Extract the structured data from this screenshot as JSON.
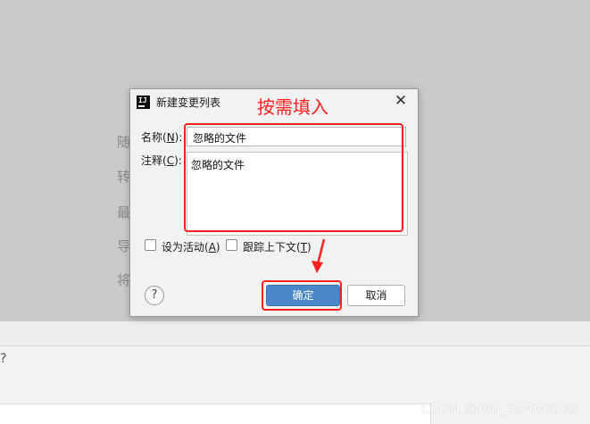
{
  "background": {
    "side_labels": [
      "随",
      "转",
      "最",
      "导",
      "将"
    ],
    "bottom_question": "?",
    "watermark": "CSDN @m0_59406039"
  },
  "dialog": {
    "app_icon": "intellij-idea-icon",
    "title": "新建变更列表",
    "close_glyph": "✕",
    "name_label": "名称(",
    "name_mnemonic": "N",
    "name_label_end": "):",
    "name_value": "忽略的文件",
    "note_label": "注释(",
    "note_mnemonic": "C",
    "note_label_end": "):",
    "note_value": "忽略的文件",
    "set_active_label": "设为活动(",
    "set_active_mnemonic": "A",
    "set_active_end": ")",
    "track_context_label": "跟踪上下文(",
    "track_context_mnemonic": "T",
    "track_context_end": ")",
    "help_glyph": "?",
    "ok_label": "确定",
    "cancel_label": "取消"
  },
  "annotation": {
    "hint_text": "按需填入",
    "color": "#ff2020"
  },
  "colors": {
    "primary_button": "#4a86c8",
    "dialog_bg": "#f2f2f2",
    "backdrop": "#cacaca"
  }
}
